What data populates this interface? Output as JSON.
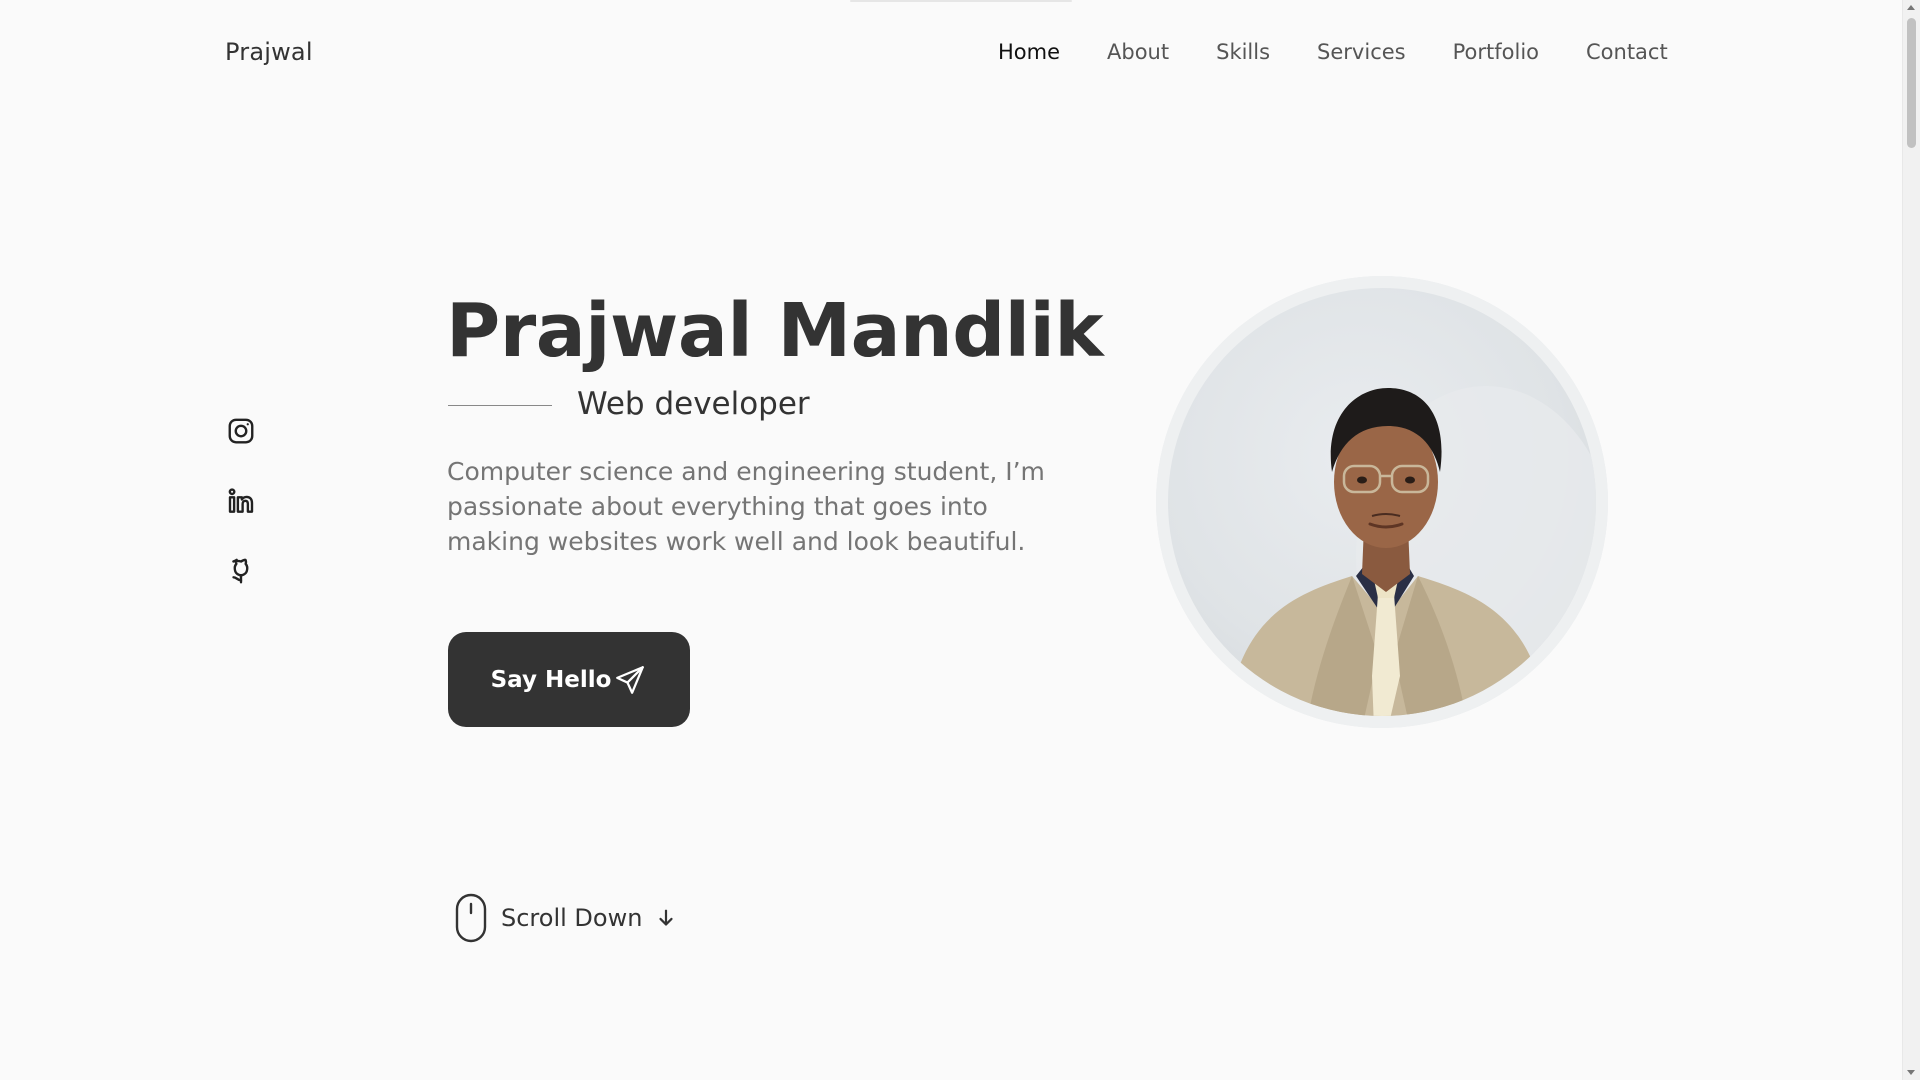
{
  "header": {
    "logo": "Prajwal",
    "nav": [
      {
        "label": "Home",
        "active": true
      },
      {
        "label": "About",
        "active": false
      },
      {
        "label": "Skills",
        "active": false
      },
      {
        "label": "Services",
        "active": false
      },
      {
        "label": "Portfolio",
        "active": false
      },
      {
        "label": "Contact",
        "active": false
      }
    ]
  },
  "social": [
    {
      "icon": "instagram-icon"
    },
    {
      "icon": "linkedin-icon"
    },
    {
      "icon": "github-icon"
    }
  ],
  "hero": {
    "name": "Prajwal Mandlik",
    "subtitle": "Web developer",
    "description": "Computer science and engineering student, I’m passionate about everything that goes into making websites work well and look beautiful.",
    "cta_label": "Say Hello",
    "cta_icon": "send-icon"
  },
  "scroll": {
    "label": "Scroll Down",
    "icons": [
      "mouse-icon",
      "arrow-down-icon"
    ]
  },
  "colors": {
    "background": "#fafafa",
    "text_dark": "#333333",
    "text_muted": "#757575",
    "button_bg": "#333333",
    "button_text": "#ffffff"
  }
}
